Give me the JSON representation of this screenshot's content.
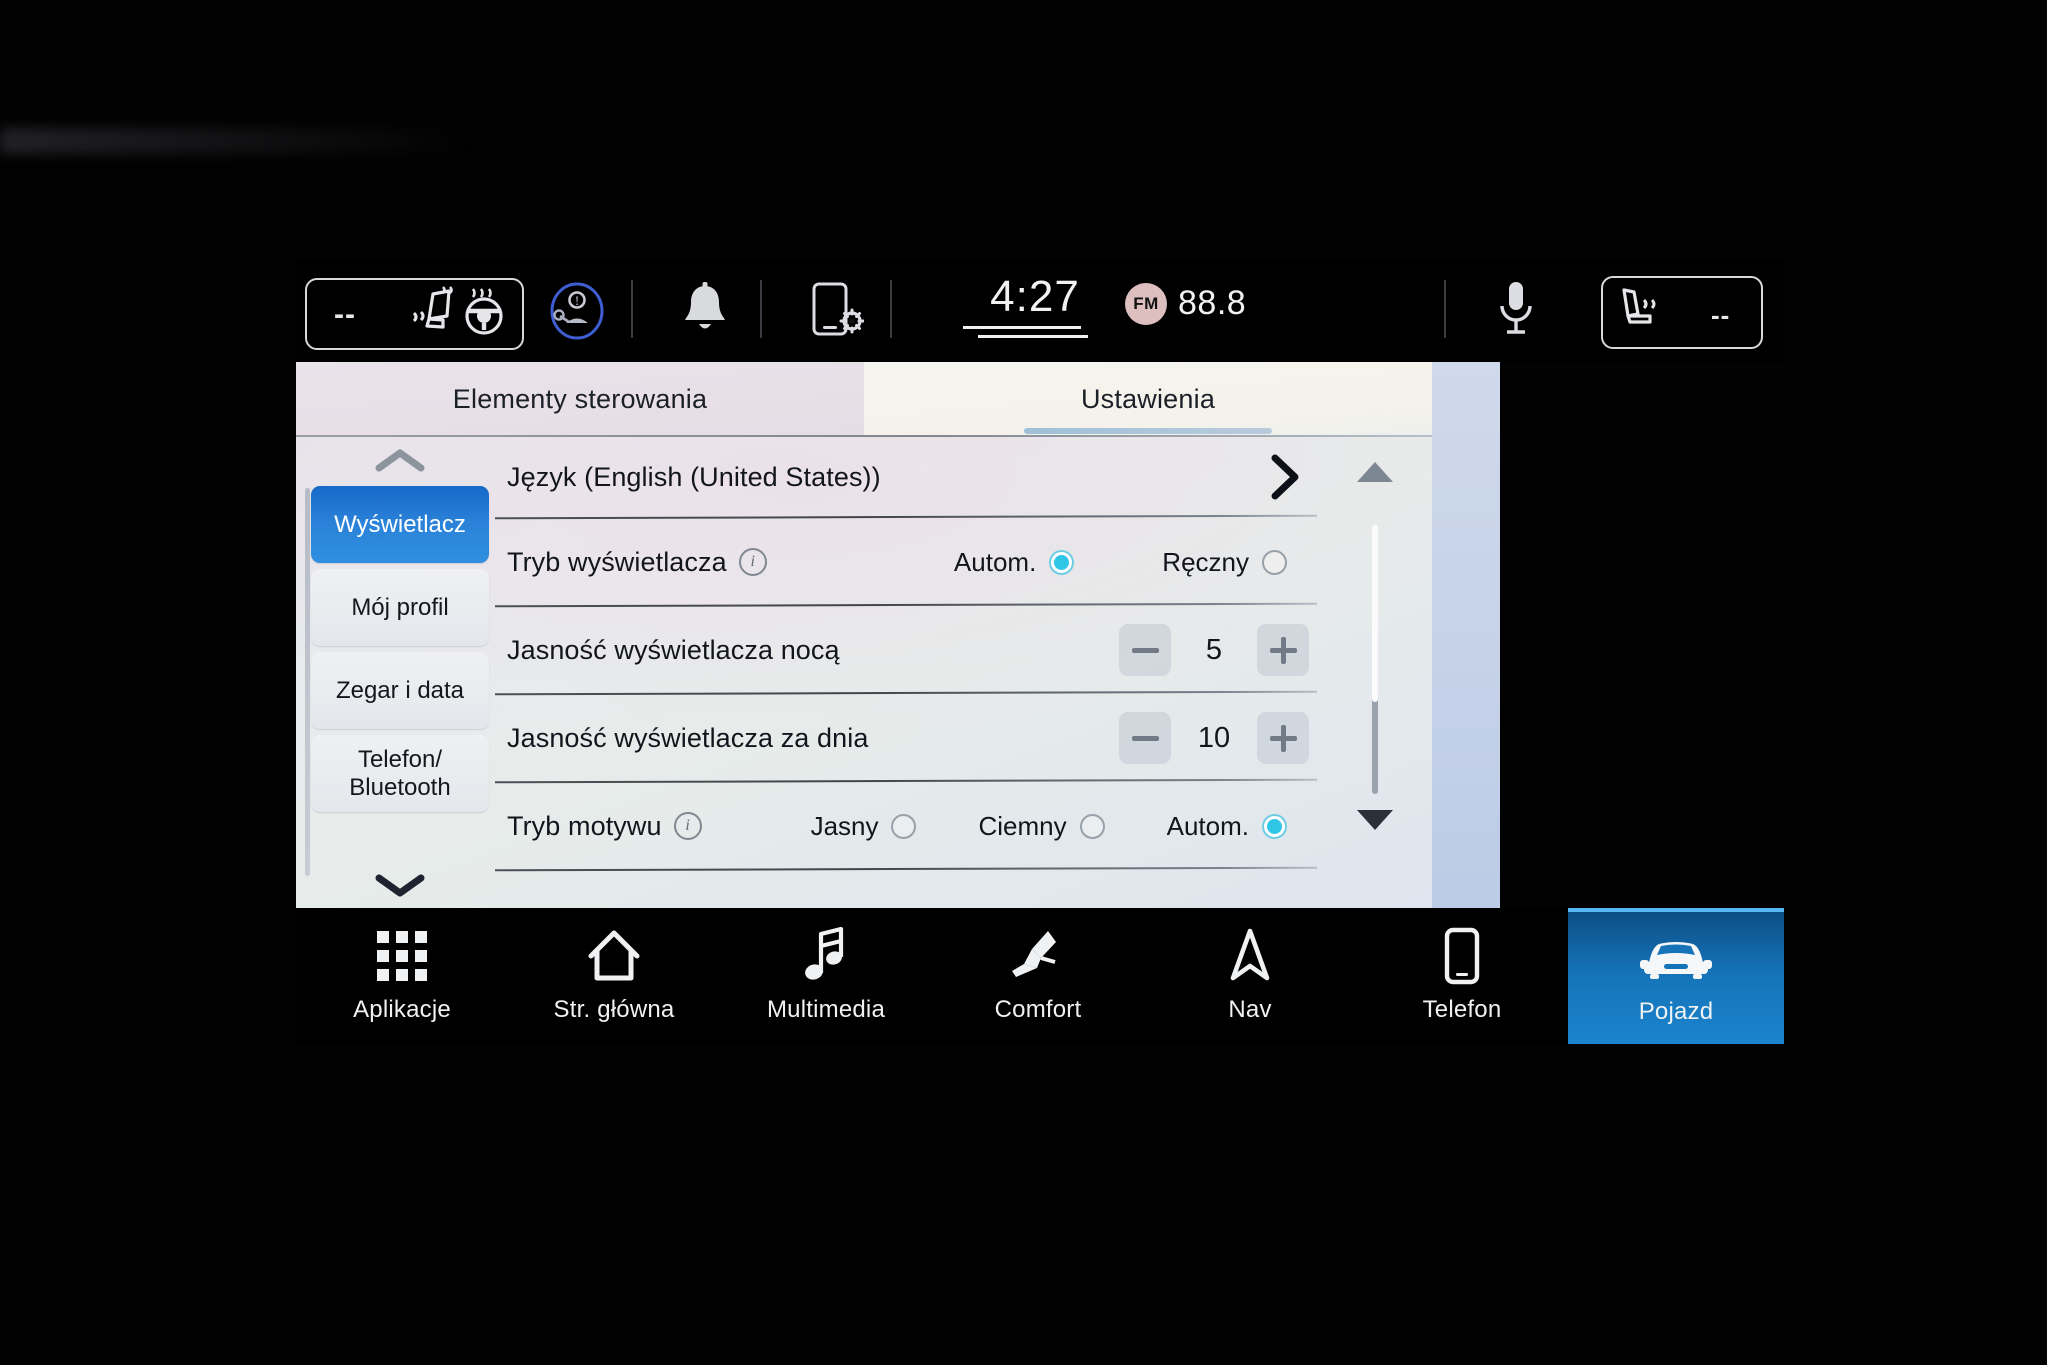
{
  "status_bar": {
    "left_cluster": {
      "temperature": "--",
      "icons": [
        "seat-heat-icon",
        "steering-wheel-heat-icon"
      ]
    },
    "icons": [
      "driver-attention-icon",
      "notification-bell-icon",
      "phone-settings-icon"
    ],
    "clock": "4:27",
    "radio": {
      "band": "FM",
      "frequency": "88.8"
    },
    "mic_icon": "microphone-icon",
    "right_cluster": {
      "temperature": "--",
      "icons": [
        "seat-heat-icon"
      ]
    }
  },
  "tabs": [
    {
      "label": "Elementy sterowania",
      "active": false
    },
    {
      "label": "Ustawienia",
      "active": true
    }
  ],
  "sidebar": {
    "scroll_up_icon": "chevron-up-icon",
    "scroll_down_icon": "chevron-down-icon",
    "items": [
      {
        "label": "Wyświetlacz",
        "active": true
      },
      {
        "label": "Mój profil",
        "active": false
      },
      {
        "label": "Zegar i data",
        "active": false
      },
      {
        "label": "Telefon/\nBluetooth",
        "active": false
      }
    ]
  },
  "settings": {
    "rows": [
      {
        "type": "link",
        "label": "Język  (English (United States))",
        "chevron_icon": "chevron-right-icon"
      },
      {
        "type": "radio",
        "label": "Tryb wyświetlacza",
        "info_icon": "info-icon",
        "options": [
          {
            "label": "Autom.",
            "selected": true
          },
          {
            "label": "Ręczny",
            "selected": false
          }
        ]
      },
      {
        "type": "stepper",
        "label": "Jasność wyświetlacza nocą",
        "value": "5",
        "minus_icon": "minus-icon",
        "plus_icon": "plus-icon"
      },
      {
        "type": "stepper",
        "label": "Jasność wyświetlacza za dnia",
        "value": "10",
        "minus_icon": "minus-icon",
        "plus_icon": "plus-icon"
      },
      {
        "type": "radio",
        "label": "Tryb motywu",
        "info_icon": "info-icon",
        "options": [
          {
            "label": "Jasny",
            "selected": false
          },
          {
            "label": "Ciemny",
            "selected": false
          },
          {
            "label": "Autom.",
            "selected": true
          }
        ]
      }
    ]
  },
  "scroll": {
    "up_icon": "triangle-up-icon",
    "down_icon": "triangle-down-icon"
  },
  "dock": {
    "items": [
      {
        "label": "Aplikacje",
        "icon": "apps-grid-icon",
        "active": false
      },
      {
        "label": "Str. główna",
        "icon": "home-icon",
        "active": false
      },
      {
        "label": "Multimedia",
        "icon": "music-note-icon",
        "active": false
      },
      {
        "label": "Comfort",
        "icon": "seat-comfort-icon",
        "active": false
      },
      {
        "label": "Nav",
        "icon": "navigation-arrow-icon",
        "active": false
      },
      {
        "label": "Telefon",
        "icon": "phone-icon",
        "active": false
      },
      {
        "label": "Pojazd",
        "icon": "car-icon",
        "active": true
      }
    ]
  },
  "colors": {
    "accent_blue": "#1b84cd",
    "radio_on": "#2fc6e6",
    "sidebar_active": "#2b82d8",
    "fm_badge": "#ddbfc0"
  }
}
